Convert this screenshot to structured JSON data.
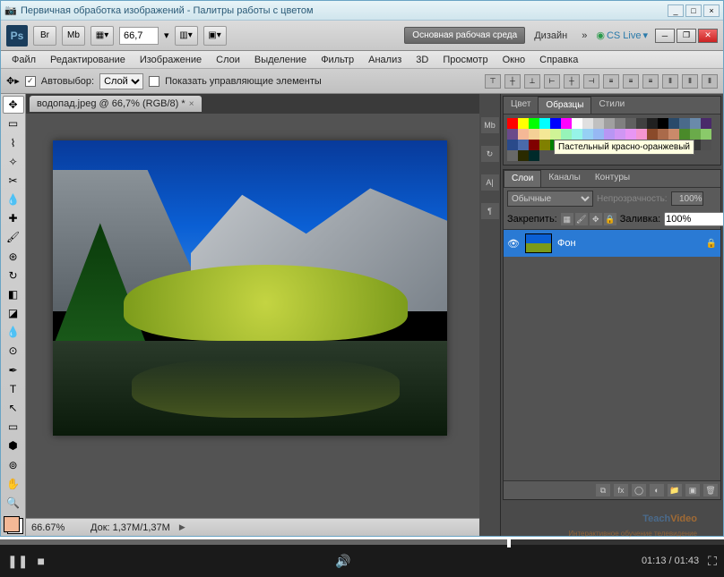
{
  "window": {
    "title": "Первичная обработка изображений - Палитры работы с цветом"
  },
  "apptoolbar": {
    "ps": "Ps",
    "zoom": "66,7",
    "workspace_main": "Основная рабочая среда",
    "workspace_design": "Дизайн",
    "cslive": "CS Live"
  },
  "menu": {
    "file": "Файл",
    "edit": "Редактирование",
    "image": "Изображение",
    "layer": "Слои",
    "select": "Выделение",
    "filter": "Фильтр",
    "analysis": "Анализ",
    "threeD": "3D",
    "view": "Просмотр",
    "window": "Окно",
    "help": "Справка"
  },
  "options": {
    "autoSelect": "Автовыбор:",
    "autoSelectValue": "Слой",
    "showControls": "Показать управляющие элементы"
  },
  "document": {
    "tab": "водопад.jpeg @ 66,7% (RGB/8) *"
  },
  "status": {
    "zoom": "66.67%",
    "doc": "Док: 1,37M/1,37M"
  },
  "panels": {
    "color": "Цвет",
    "swatches": "Образцы",
    "styles": "Стили",
    "tooltip": "Пастельный красно-оранжевый",
    "layers": "Слои",
    "channels": "Каналы",
    "paths": "Контуры"
  },
  "layers": {
    "mode": "Обычные",
    "opacityLabel": "Непрозрачность:",
    "opacity": "100%",
    "lockLabel": "Закрепить:",
    "fillLabel": "Заливка:",
    "fill": "100%",
    "bgLayer": "Фон"
  },
  "swatch_colors": [
    "#ff0000",
    "#ffff00",
    "#00ff00",
    "#00ffff",
    "#0000ff",
    "#ff00ff",
    "#ffffff",
    "#e0e0e0",
    "#c0c0c0",
    "#a0a0a0",
    "#808080",
    "#606060",
    "#404040",
    "#202020",
    "#000000",
    "#2a4a6a",
    "#4a6a8a",
    "#6a8aaa",
    "#4a2a6a",
    "#6a4a8a",
    "#f4b896",
    "#f4d096",
    "#f4e896",
    "#d0f496",
    "#96f4b8",
    "#96f4e8",
    "#96d0f4",
    "#96b8f4",
    "#b896f4",
    "#d096f4",
    "#e896f4",
    "#f496d0",
    "#8a4a2a",
    "#aa6a4a",
    "#ca8a6a",
    "#4a8a2a",
    "#6aaa4a",
    "#8aca6a",
    "#2a4a8a",
    "#4a6aaa",
    "#800000",
    "#808000",
    "#008000",
    "#008080",
    "#000080",
    "#800080",
    "#402000",
    "#604020",
    "#204000",
    "#406020",
    "#002040",
    "#204060",
    "#400020",
    "#602040",
    "#202020",
    "#383838",
    "#505050",
    "#686868",
    "#2a2a00",
    "#002a2a"
  ],
  "watermark": {
    "t": "Teach",
    "v": "Video",
    "sub": "Интерактивное обучение телевидение"
  },
  "player": {
    "time": "01:13 / 01:43"
  }
}
